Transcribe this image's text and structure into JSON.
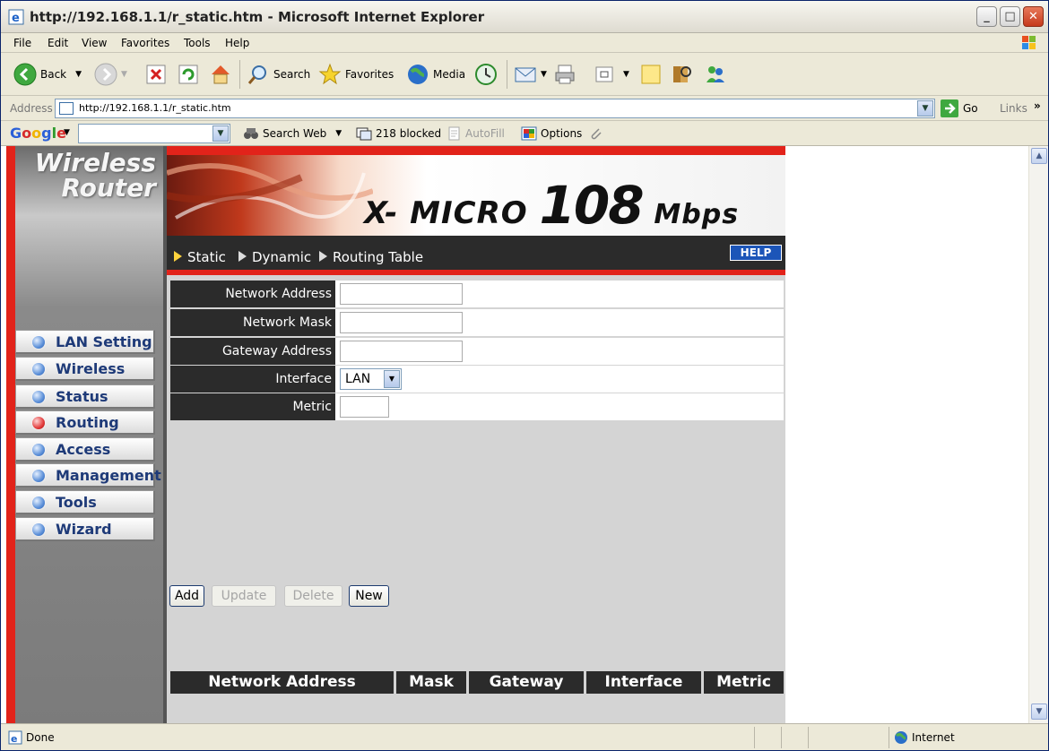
{
  "window": {
    "title": "http://192.168.1.1/r_static.htm - Microsoft Internet Explorer"
  },
  "menu": [
    "File",
    "Edit",
    "View",
    "Favorites",
    "Tools",
    "Help"
  ],
  "toolbar": {
    "back": "Back",
    "search": "Search",
    "favorites": "Favorites",
    "media": "Media"
  },
  "address": {
    "label": "Address",
    "url": "http://192.168.1.1/r_static.htm",
    "go": "Go",
    "links": "Links"
  },
  "google": {
    "logo": "Google",
    "search_web": "Search Web",
    "blocked": "218 blocked",
    "autofill": "AutoFill",
    "options": "Options"
  },
  "router": {
    "brand_line1": "Wireless",
    "brand_line2": "Router",
    "banner_prefix": "X- MICRO",
    "banner_num": "108",
    "banner_unit": "Mbps",
    "nav": [
      "LAN Setting",
      "Wireless",
      "Status",
      "Routing",
      "Access",
      "Management",
      "Tools",
      "Wizard"
    ],
    "active_nav": "Routing",
    "tabs": [
      "Static",
      "Dynamic",
      "Routing Table"
    ],
    "help": "HELP",
    "form": {
      "network_address_label": "Network Address",
      "network_address_value": "",
      "network_mask_label": "Network Mask",
      "network_mask_value": "",
      "gateway_label": "Gateway Address",
      "gateway_value": "",
      "interface_label": "Interface",
      "interface_value": "LAN",
      "metric_label": "Metric",
      "metric_value": ""
    },
    "buttons": {
      "add": "Add",
      "update": "Update",
      "delete": "Delete",
      "new": "New"
    },
    "table_headers": [
      "Network Address",
      "Mask",
      "Gateway",
      "Interface",
      "Metric"
    ]
  },
  "status": {
    "text": "Done",
    "zone": "Internet"
  },
  "colors": {
    "accent_red": "#e2231a",
    "dark_bar": "#2b2b2b",
    "nav_text": "#1e3a78"
  }
}
